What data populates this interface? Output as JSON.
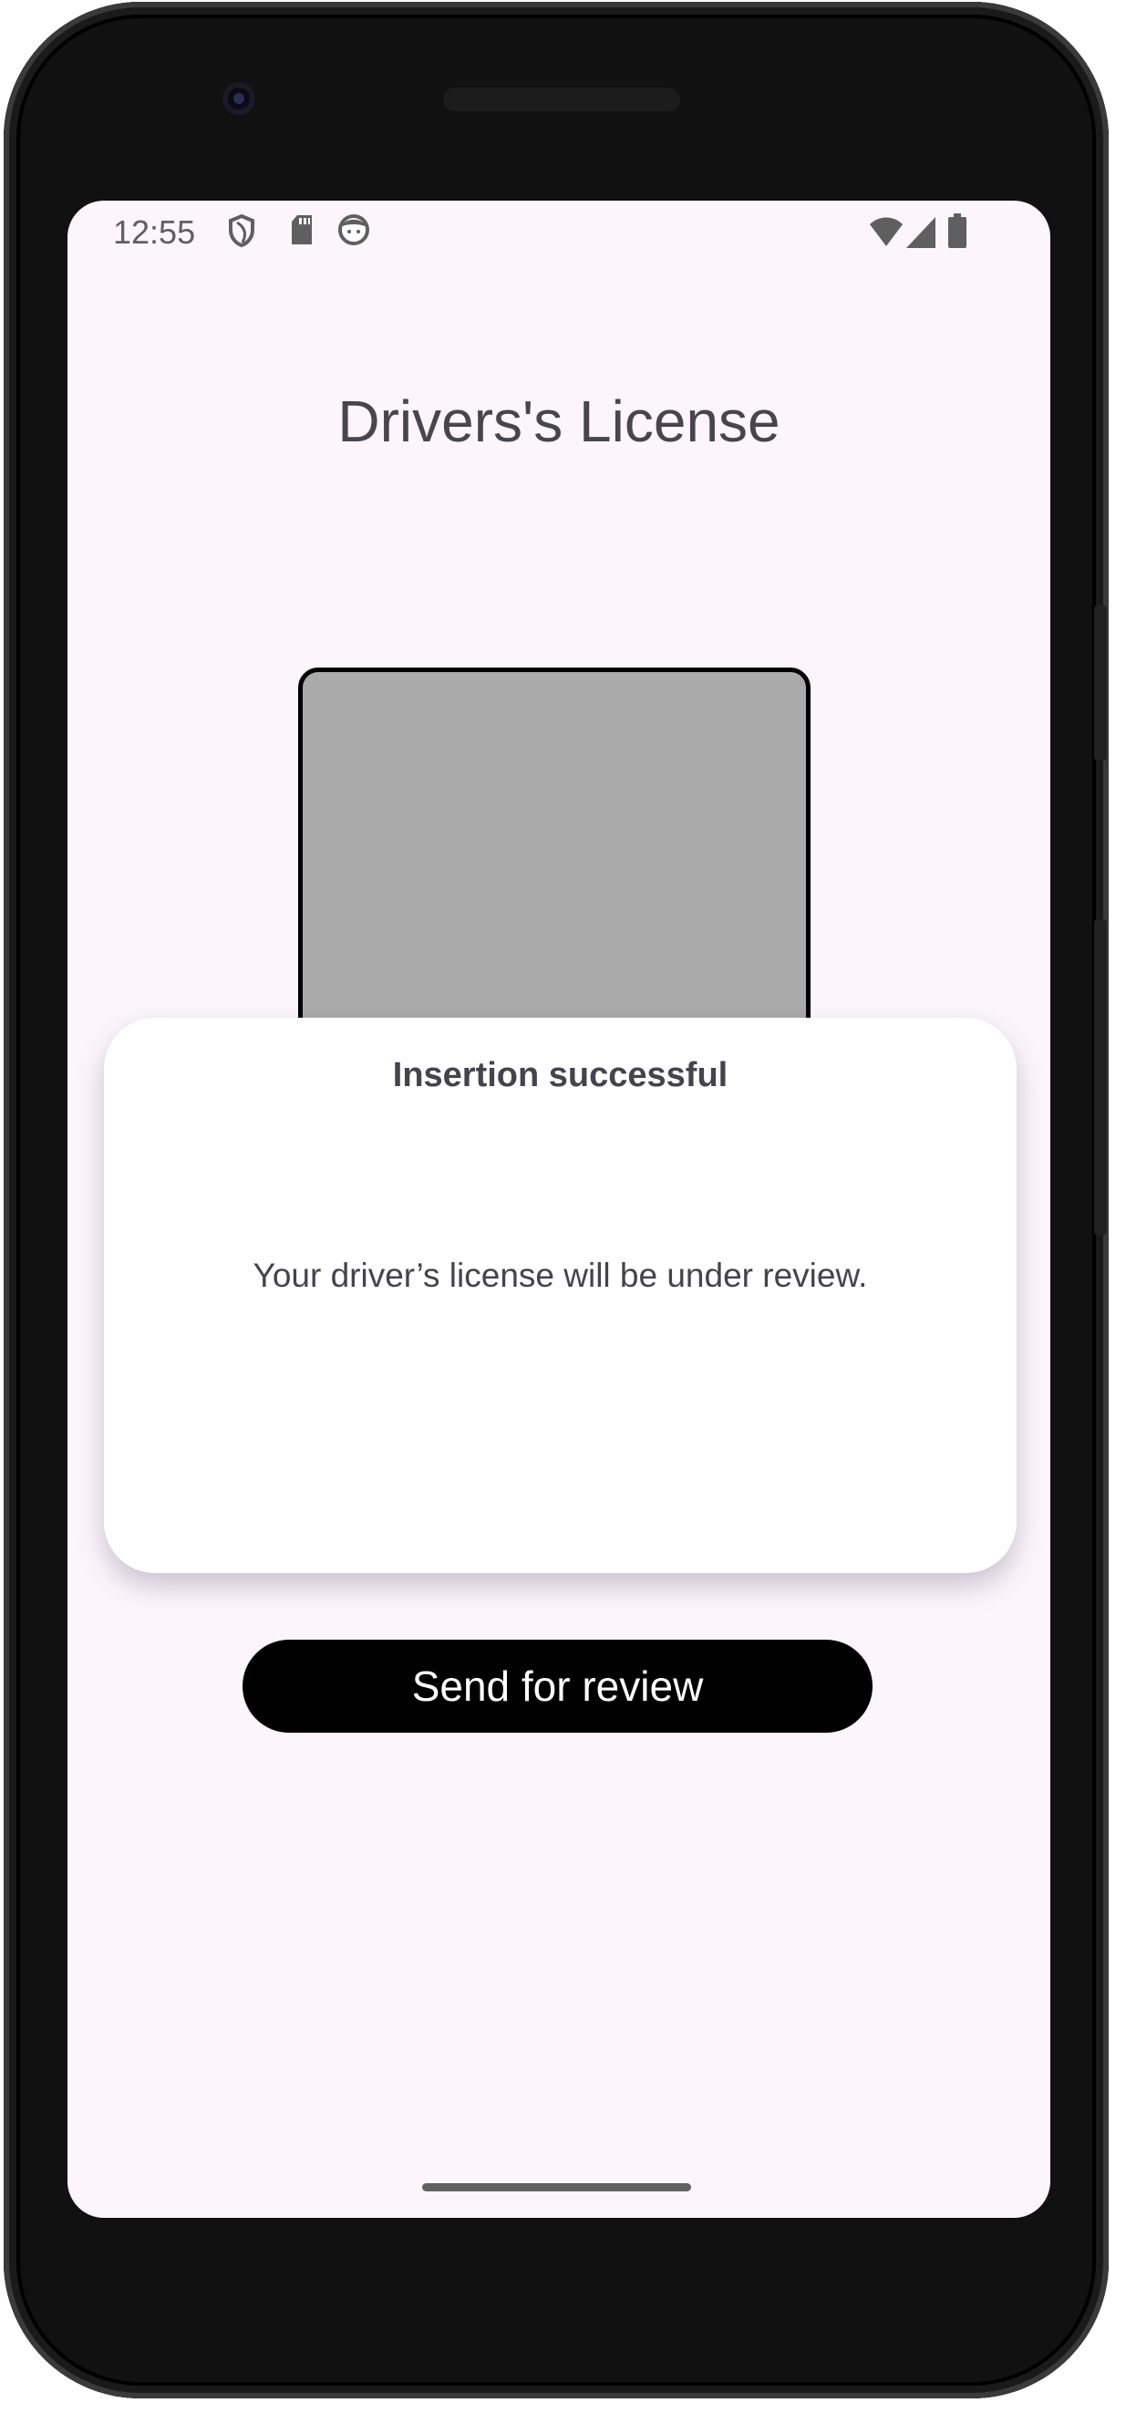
{
  "status_bar": {
    "time": "12:55",
    "left_icons": [
      "shield-icon",
      "sd-card-icon",
      "face-icon"
    ],
    "right_icons": [
      "wifi-icon",
      "signal-icon",
      "battery-icon"
    ]
  },
  "page": {
    "title": "Drivers's License"
  },
  "dialog": {
    "title": "Insertion successful",
    "message": "Your driver’s license will be under review."
  },
  "actions": {
    "send_label": "Send for review"
  },
  "colors": {
    "background": "#fcf6fc",
    "text": "#49454f",
    "button": "#000000",
    "placeholder": "#aaaaaa"
  }
}
